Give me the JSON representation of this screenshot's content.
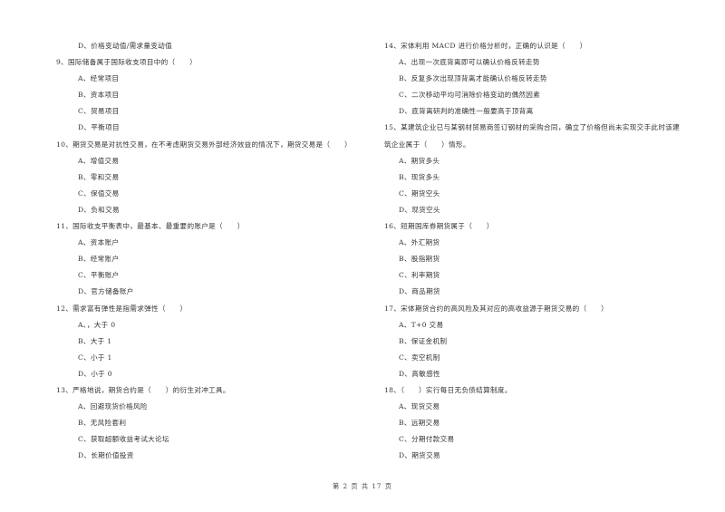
{
  "left_column": {
    "carry_over": "D、价格变动值/需求量变动值",
    "questions": [
      {
        "stem": "9、国际储备属于国际收支项目中的（　　）",
        "options": [
          "A、经常项目",
          "B、资本项目",
          "C、贸易项目",
          "D、平衡项目"
        ]
      },
      {
        "stem": "10、期货交易是对抗性交易，在不考虑期货交易外部经济效益的情况下，期货交易是（　　）",
        "options": [
          "A、增值交易",
          "B、零和交易",
          "C、保值交易",
          "D、负和交易"
        ]
      },
      {
        "stem": "11、国际收支平衡表中，最基本、最重要的账户是（　　）",
        "options": [
          "A、资本账户",
          "B、经常账户",
          "C、平衡账户",
          "D、官方储备账户"
        ]
      },
      {
        "stem": "12、需求富有弹性是指需求弹性（　　）",
        "options": [
          "A、，大于 0",
          "B、大于 1",
          "C、小于 1",
          "D、小于 0"
        ]
      },
      {
        "stem": "13、严格地说，期货合约是（　　）的衍生对冲工具。",
        "options": [
          "A、回避现货价格风险",
          "B、无风险套利",
          "C、获取超额收益考试大论坛",
          "D、长期价值投资"
        ]
      }
    ]
  },
  "right_column": {
    "questions": [
      {
        "stem": "14、宋体利用 MACD 进行价格分析时，正确的认识是（　　）",
        "options": [
          "A、出现一次底背离即可以确认价格反转走势",
          "B、反复多次出现顶背离才能确认价格反转走势",
          "C、二次移动平均可消除价格变动的偶然因素",
          "D、底背离研判的准确性一般要高于顶背离"
        ]
      },
      {
        "stem_line1": "15、某建筑企业已与某钢材贸易商签订钢材的采购合同，确立了价格但尚未实现交手此时该建",
        "stem_line2": "筑企业属于（　　）情形。",
        "options": [
          "A、期货多头",
          "B、现货多头",
          "C、期货空头",
          "D、现货空头"
        ]
      },
      {
        "stem": "16、短期国库券期货属于（　　）",
        "options": [
          "A、外汇期货",
          "B、股指期货",
          "C、利率期货",
          "D、商品期货"
        ]
      },
      {
        "stem": "17、宋体期货合约的高风险及其对应的高收益源于期货交易的（　　）",
        "options": [
          "A、T+0 交易",
          "B、保证金机制",
          "C、卖空机制",
          "D、高敏感性"
        ]
      },
      {
        "stem": "18、（　　）实行每日无负债结算制度。",
        "options": [
          "A、现货交易",
          "B、远期交易",
          "C、分期付款交易",
          "D、期货交易"
        ]
      }
    ]
  },
  "footer": {
    "page_label": "第 2 页 共 17 页"
  }
}
